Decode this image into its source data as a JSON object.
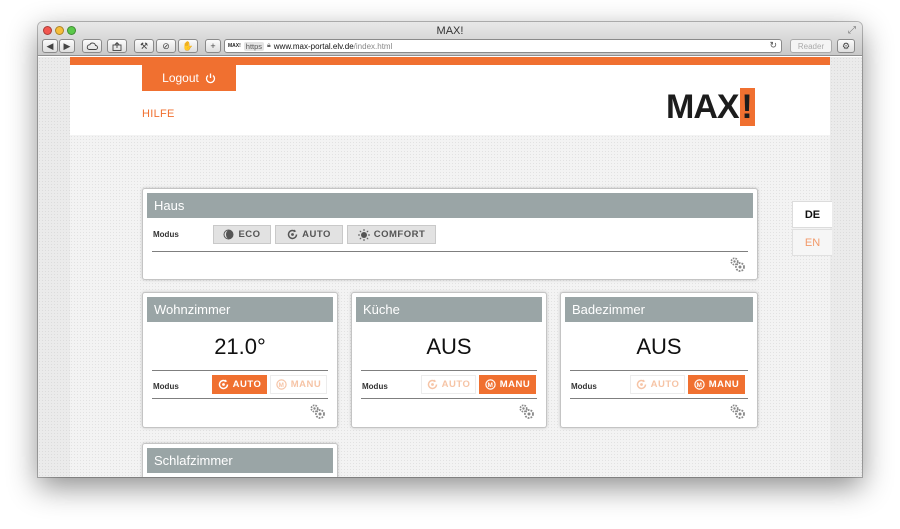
{
  "browser": {
    "title": "MAX!",
    "url": {
      "favicon": "MAX!",
      "scheme": "https",
      "host": "www.max-portal.elv.de",
      "path": "/index.html"
    },
    "reader_label": "Reader",
    "toolbar_icons": [
      "back-icon",
      "forward-icon",
      "cloud-icon",
      "share-icon",
      "wrench-icon",
      "stop-icon",
      "hand-icon",
      "add-icon",
      "gear-icon"
    ]
  },
  "header": {
    "logout_label": "Logout",
    "hilfe_label": "HILFE",
    "logo_text": "MAX",
    "logo_bang": "!"
  },
  "languages": {
    "de": "DE",
    "en": "EN"
  },
  "house": {
    "title": "Haus",
    "modus_label": "Modus",
    "buttons": {
      "eco": "ECO",
      "auto": "AUTO",
      "comfort": "COMFORT"
    }
  },
  "rooms": [
    {
      "name": "Wohnzimmer",
      "value": "21.0°",
      "modus_label": "Modus",
      "auto_label": "AUTO",
      "manu_label": "MANU",
      "active": "auto"
    },
    {
      "name": "Küche",
      "value": "AUS",
      "modus_label": "Modus",
      "auto_label": "AUTO",
      "manu_label": "MANU",
      "active": "manu"
    },
    {
      "name": "Badezimmer",
      "value": "AUS",
      "modus_label": "Modus",
      "auto_label": "AUTO",
      "manu_label": "MANU",
      "active": "manu"
    },
    {
      "name": "Schlafzimmer"
    }
  ],
  "colors": {
    "accent": "#f07030",
    "header_grey": "#9aa5a6"
  }
}
